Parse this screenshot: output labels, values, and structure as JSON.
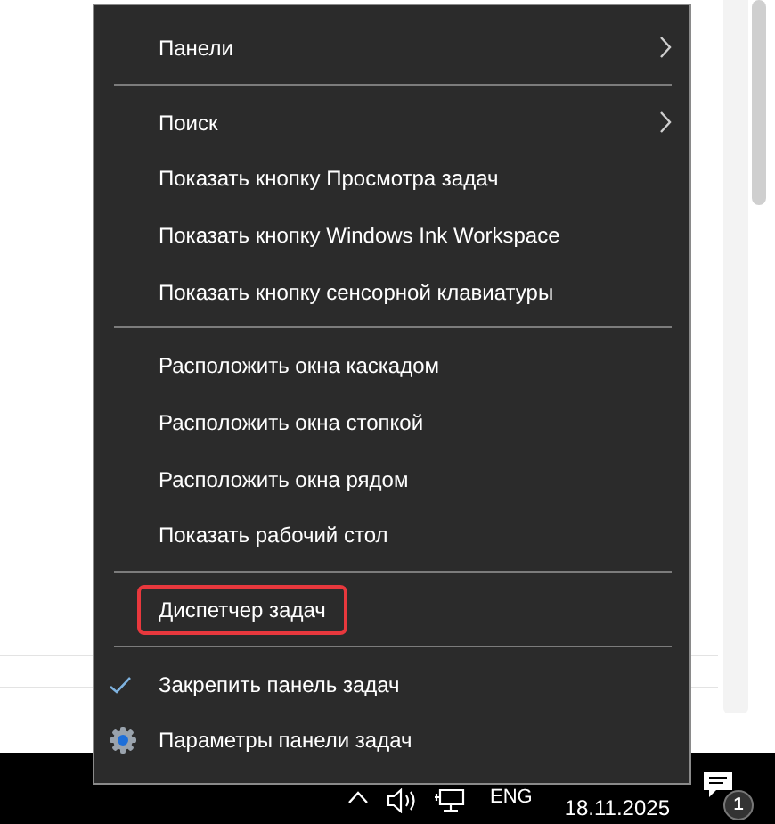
{
  "context_menu": {
    "sections": [
      {
        "items": [
          {
            "label": "Панели",
            "kind": "submenu",
            "highlighted": false
          }
        ]
      },
      {
        "items": [
          {
            "label": "Поиск",
            "kind": "submenu",
            "highlighted": false
          },
          {
            "label": "Показать кнопку Просмотра задач",
            "kind": "plain",
            "highlighted": false
          },
          {
            "label": "Показать кнопку Windows Ink Workspace",
            "kind": "plain",
            "highlighted": false
          },
          {
            "label": "Показать кнопку сенсорной клавиатуры",
            "kind": "plain",
            "highlighted": false
          }
        ]
      },
      {
        "items": [
          {
            "label": "Расположить окна каскадом",
            "kind": "plain",
            "highlighted": false
          },
          {
            "label": "Расположить окна стопкой",
            "kind": "plain",
            "highlighted": false
          },
          {
            "label": "Расположить окна рядом",
            "kind": "plain",
            "highlighted": false
          },
          {
            "label": "Показать рабочий стол",
            "kind": "plain",
            "highlighted": false
          }
        ]
      },
      {
        "items": [
          {
            "label": "Диспетчер задач",
            "kind": "plain",
            "highlighted": true
          }
        ]
      },
      {
        "items": [
          {
            "label": "Закрепить панель задач",
            "kind": "check",
            "checked": true,
            "highlighted": false
          },
          {
            "label": "Параметры панели задач",
            "kind": "settings",
            "highlighted": false
          }
        ]
      }
    ]
  },
  "taskbar": {
    "language": "ENG",
    "date": "18.11.2025",
    "notification_count": "1"
  }
}
